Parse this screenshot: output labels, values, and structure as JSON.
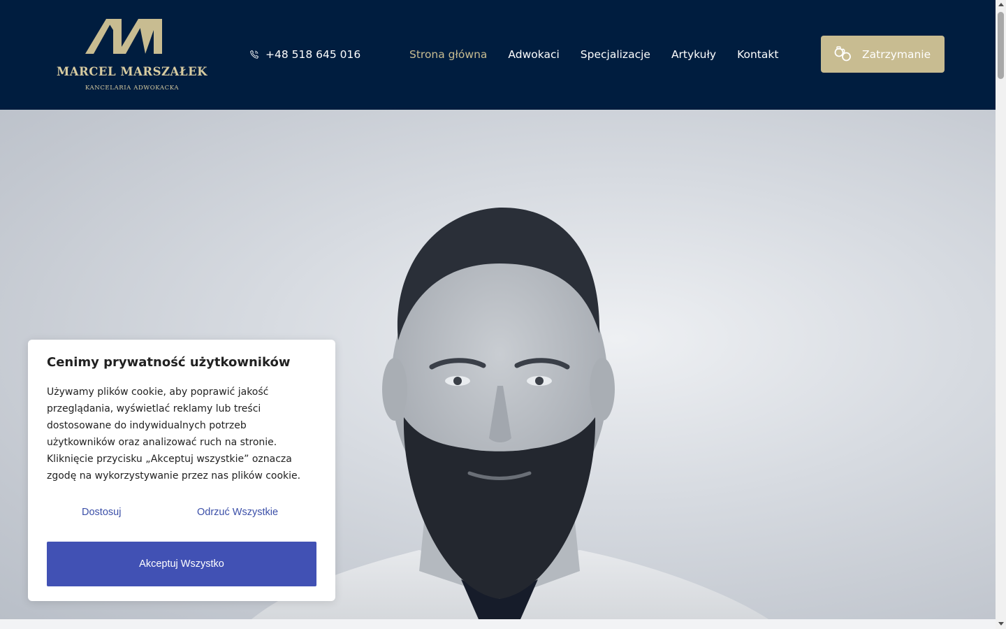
{
  "logo": {
    "monogram": "MM",
    "name": "MARCEL MARSZAŁEK",
    "subtitle": "KANCELARIA ADWOKACKA"
  },
  "header": {
    "phone": "+48 518 645 016",
    "phone_icon": "phone-icon",
    "nav": [
      {
        "label": "Strona główna",
        "active": true
      },
      {
        "label": "Adwokaci",
        "active": false
      },
      {
        "label": "Specjalizacje",
        "active": false
      },
      {
        "label": "Artykuły",
        "active": false
      },
      {
        "label": "Kontakt",
        "active": false
      }
    ],
    "cta": {
      "label": "Zatrzymanie",
      "icon": "handcuffs-icon"
    }
  },
  "colors": {
    "header_bg": "#001d3f",
    "gold": "#c8bc91",
    "accept_button": "#4151b4",
    "link": "#3b4fa8"
  },
  "cookie_banner": {
    "title": "Cenimy prywatność użytkowników",
    "text": "Używamy plików cookie, aby poprawić jakość przeglądania, wyświetlać reklamy lub treści dostosowane do indywidualnych potrzeb użytkowników oraz analizować ruch na stronie. Kliknięcie przycisku „Akceptuj wszystkie” oznacza zgodę na wykorzystywanie przez nas plików cookie.",
    "customize": "Dostosuj",
    "reject": "Odrzuć Wszystkie",
    "accept": "Akceptuj Wszystko"
  }
}
